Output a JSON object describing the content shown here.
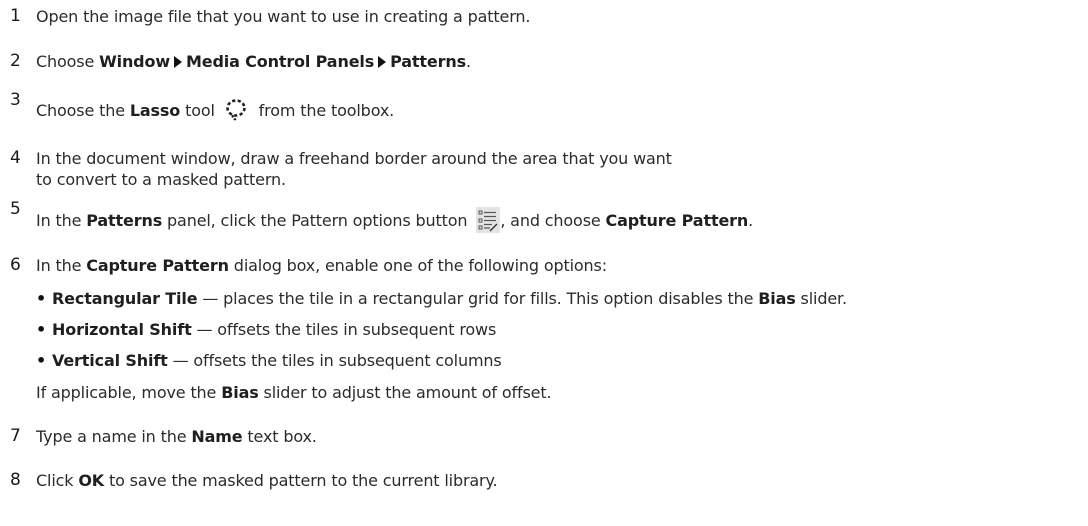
{
  "steps": [
    {
      "num": "1",
      "text": "Open the image file that you want to use in creating a pattern."
    },
    {
      "num": "2",
      "pre": "Choose ",
      "menu1": "Window",
      "menu2": "Media Control Panels",
      "menu3": "Patterns",
      "post": "."
    },
    {
      "num": "3",
      "pre": "Choose the ",
      "tool": "Lasso",
      "mid": " tool",
      "post": " from the toolbox.",
      "icon": "lasso-icon"
    },
    {
      "num": "4",
      "text": "In the document window, draw a freehand border around the area that you want to convert to a masked pattern."
    },
    {
      "num": "5",
      "pre": "In the ",
      "panel": "Patterns",
      "mid": " panel, click the Pattern options button ",
      "post": ", and choose ",
      "cmd": "Capture Pattern",
      "end": ".",
      "icon": "pattern-options-icon"
    },
    {
      "num": "6",
      "pre": "In the ",
      "dialog": "Capture Pattern",
      "post": " dialog box, enable one of the following options:"
    },
    {
      "num": "7",
      "pre": "Type a name in the ",
      "field": "Name",
      "post": " text box."
    },
    {
      "num": "8",
      "pre": "Click ",
      "btn": "OK",
      "post": " to save the masked pattern to the current library."
    }
  ],
  "options": [
    {
      "bullet": "•",
      "name": "Rectangular Tile",
      "desc": " — places the tile in a rectangular grid for fills. This option disables the ",
      "ref": "Bias",
      "end": " slider."
    },
    {
      "bullet": "•",
      "name": "Horizontal Shift",
      "desc": " — offsets the tiles in subsequent rows"
    },
    {
      "bullet": "•",
      "name": "Vertical Shift",
      "desc": " — offsets the tiles in subsequent columns"
    }
  ],
  "note": {
    "pre": "If applicable, move the ",
    "ref": "Bias",
    "post": " slider to adjust the amount of offset."
  }
}
